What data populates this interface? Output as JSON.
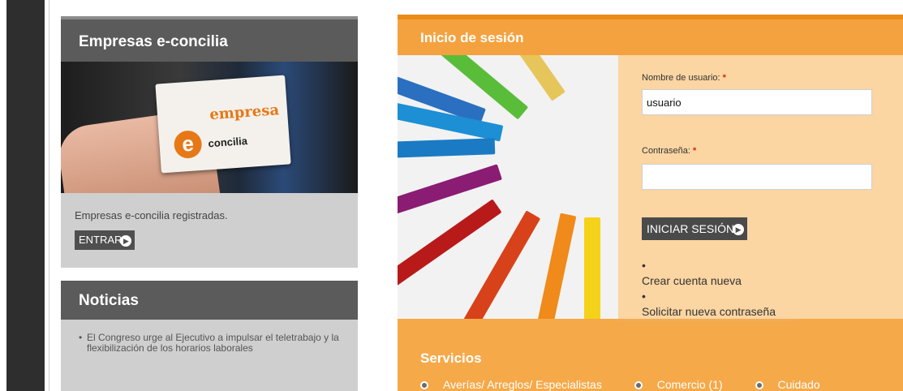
{
  "empresas": {
    "title": "Empresas e-concilia",
    "card_word": "empresa",
    "card_e": "e",
    "card_word2": "concilia",
    "description": "Empresas e-concilia registradas.",
    "enter_label": "ENTRAR"
  },
  "noticias": {
    "title": "Noticias",
    "items": [
      "El Congreso urge al Ejecutivo a impulsar el teletrabajo y la flexibilización de los horarios laborales"
    ]
  },
  "login": {
    "title": "Inicio de sesión",
    "username_label": "Nombre de usuario:",
    "username_value": "usuario",
    "password_label": "Contraseña:",
    "password_value": "",
    "required_mark": "*",
    "submit_label": "INICIAR SESIÓN",
    "links": [
      "Crear cuenta nueva",
      "Solicitar nueva contraseña"
    ]
  },
  "servicios": {
    "title": "Servicios",
    "items": [
      "Averías/ Arreglos/ Especialistas",
      "Comercio (1)",
      "Cuidado"
    ]
  },
  "colors": {
    "orange_accent": "#f5a949",
    "dark_header": "#5b5b5b",
    "brand_orange": "#e77817"
  },
  "icons": {
    "enter_arrow": "arrow-right-circle-icon",
    "login_arrow": "arrow-right-circle-icon",
    "radio": "radio-dot-icon"
  }
}
